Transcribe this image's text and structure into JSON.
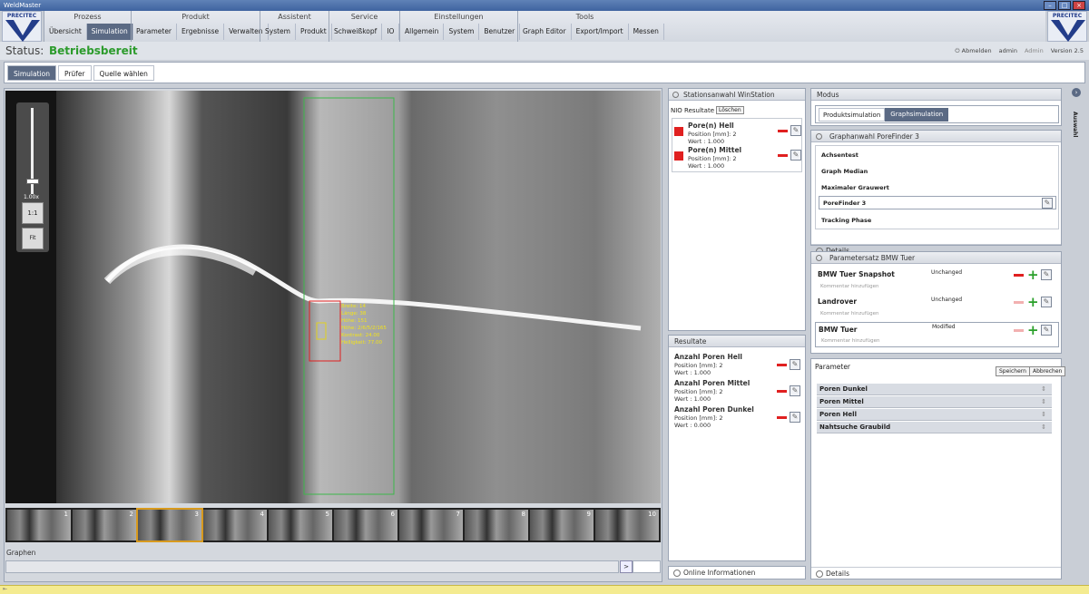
{
  "window_title": "WeldMaster",
  "logo_text": "PRECITEC",
  "menu": {
    "groups": [
      {
        "header": "Prozess",
        "items": [
          "Übersicht",
          "Simulation"
        ]
      },
      {
        "header": "Produkt",
        "items": [
          "Parameter",
          "Ergebnisse",
          "Verwalten"
        ]
      },
      {
        "header": "Assistent",
        "items": [
          "System",
          "Produkt"
        ]
      },
      {
        "header": "Service",
        "items": [
          "Schweißkopf",
          "IO"
        ]
      },
      {
        "header": "Einstellungen",
        "items": [
          "Allgemein",
          "System",
          "Benutzer"
        ]
      },
      {
        "header": "Tools",
        "items": [
          "Graph Editor",
          "Export/Import",
          "Messen"
        ]
      }
    ],
    "selected": "Simulation"
  },
  "status": {
    "label": "Status:",
    "value": "Betriebsbereit"
  },
  "userinfo": {
    "logout": "Abmelden",
    "user": "admin",
    "role": "Admin",
    "version": "Version 2.5"
  },
  "subnav": [
    "Simulation",
    "Prüfer",
    "Quelle wählen"
  ],
  "viewer": {
    "zoom_label": "1.00x",
    "btn_1to1": "1:1",
    "btn_fit": "Fit",
    "overlay_lines": [
      "Breite: 14",
      "Länge: 38",
      "Höhe: 151",
      "Höhe: 2/6/5/2/165",
      "Kontrast: 24.00",
      "Helligkeit: 77.00"
    ]
  },
  "filmstrip": [
    "1",
    "2",
    "3",
    "4",
    "5",
    "6",
    "7",
    "8",
    "9",
    "10"
  ],
  "filmstrip_selected": 3,
  "graphen_label": "Graphen",
  "graphen_btn": ">",
  "station_panel": {
    "title": "Stationsanwahl WinStation",
    "nio_label": "NIO Resultate",
    "clear_btn": "Löschen",
    "items": [
      {
        "name": "Pore(n) Hell",
        "position": "Position [mm]: 2",
        "value": "Wert   : 1.000"
      },
      {
        "name": "Pore(n) Mittel",
        "position": "Position [mm]: 2",
        "value": "Wert   : 1.000"
      }
    ]
  },
  "resultate_panel": {
    "title": "Resultate",
    "items": [
      {
        "name": "Anzahl Poren Hell",
        "position": "Position [mm]: 2",
        "value": "Wert   : 1.000"
      },
      {
        "name": "Anzahl Poren Mittel",
        "position": "Position [mm]: 2",
        "value": "Wert   : 1.000"
      },
      {
        "name": "Anzahl Poren Dunkel",
        "position": "Position [mm]: 2",
        "value": "Wert   : 0.000"
      }
    ]
  },
  "online_info": "Online Informationen",
  "modus": {
    "title": "Modus",
    "options": [
      "Produktsimulation",
      "Graphsimulation"
    ],
    "selected": "Graphsimulation"
  },
  "graphanwahl": {
    "title": "Graphanwahl PoreFinder 3",
    "items": [
      "Achsentest",
      "Graph Median",
      "Maximaler Grauwert",
      "PoreFinder 3",
      "Tracking Phase"
    ],
    "selected": "PoreFinder 3",
    "details": "Details"
  },
  "parametersatz": {
    "title": "Parametersatz BMW Tuer",
    "items": [
      {
        "name": "BMW Tuer Snapshot",
        "state": "Unchanged",
        "comment": "Kommentar hinzufügen"
      },
      {
        "name": "Landrover",
        "state": "Unchanged",
        "comment": "Kommentar hinzufügen"
      },
      {
        "name": "BMW Tuer",
        "state": "Modified",
        "comment": "Kommentar hinzufügen"
      }
    ]
  },
  "parameter": {
    "title": "Parameter",
    "save_btn": "Speichern",
    "cancel_btn": "Abbrechen",
    "items": [
      "Poren Dunkel",
      "Poren Mittel",
      "Poren Hell",
      "Nahtsuche Graubild"
    ],
    "details": "Details"
  },
  "side_tab": "Auswahl",
  "colors": {
    "accent": "#5b6a84",
    "status_ok": "#2c9b2c",
    "error": "#e02020",
    "add": "#2aa02a",
    "selection_box": "#3cb84a",
    "filmstrip_sel": "#d89a1e"
  }
}
